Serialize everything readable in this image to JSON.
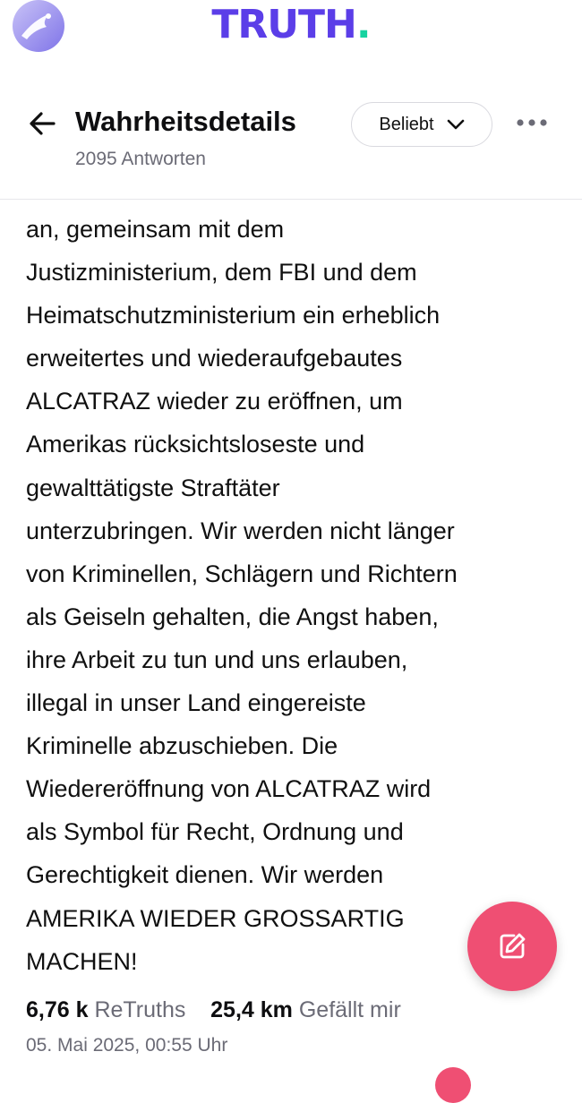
{
  "app": {
    "logo_text": "TRUTH",
    "logo_dot": ".",
    "brand_color": "#5b3ee8",
    "accent_dot_color": "#16d3a0"
  },
  "header": {
    "title": "Wahrheitsdetails",
    "reply_count": "2095 Antworten",
    "sort_label": "Beliebt",
    "back_icon": "arrow-left-icon",
    "more_icon": "more-horizontal-icon"
  },
  "post": {
    "body": "an, gemeinsam mit dem\nJustizministerium, dem FBI und dem\nHeimatschutzministerium ein erheblich\nerweitertes und wiederaufgebautes\nALCATRAZ wieder zu eröffnen, um\nAmerikas rücksichtsloseste und\ngewalttätigste Straftäter\nunterzubringen. Wir werden nicht länger\nvon Kriminellen, Schlägern und Richtern\nals Geiseln gehalten, die Angst haben,\nihre Arbeit zu tun und uns erlauben,\nillegal in unser Land eingereiste\nKriminelle abzuschieben. Die\nWiedereröffnung von ALCATRAZ wird\nals Symbol für Recht, Ordnung und\nGerechtigkeit dienen. Wir werden\nAMERIKA WIEDER GROSSARTIG\nMACHEN!",
    "retruths_count": "6,76 k",
    "retruths_label": "ReTruths",
    "likes_count": "25,4 km",
    "likes_label": "Gefällt mir",
    "timestamp": "05. Mai 2025, 00:55 Uhr"
  },
  "fab": {
    "icon": "compose-icon",
    "color": "#ef4f73"
  }
}
